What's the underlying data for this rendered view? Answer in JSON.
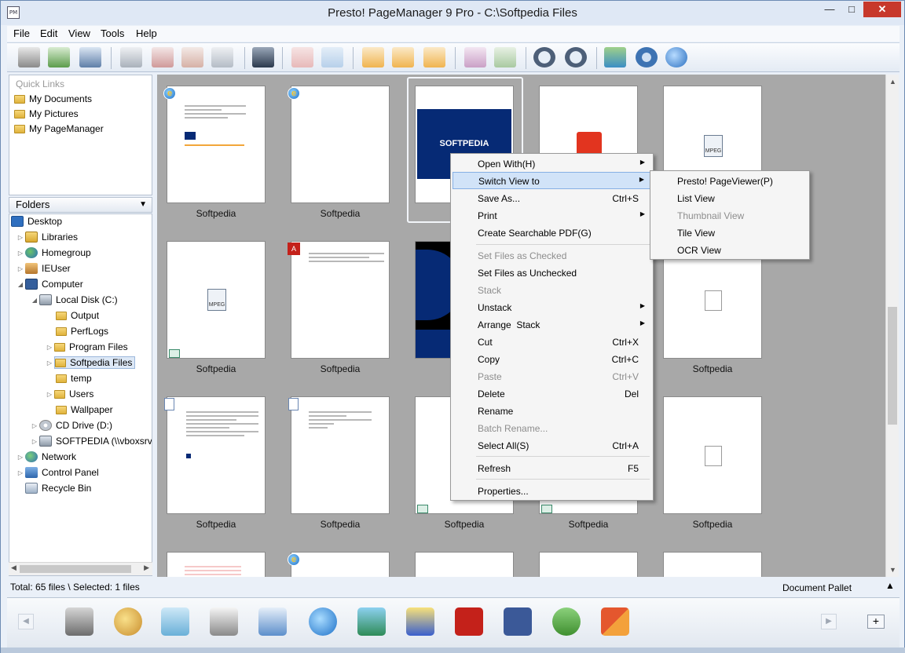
{
  "window": {
    "title": "Presto! PageManager 9 Pro - C:\\Softpedia Files",
    "app_icon_text": "PM",
    "controls": {
      "minimize": "—",
      "maximize": "□",
      "close": "✕"
    }
  },
  "menubar": [
    "File",
    "Edit",
    "View",
    "Tools",
    "Help"
  ],
  "toolbar": {
    "icons": [
      "scanner-icon",
      "acquire-icon",
      "scan-settings-icon",
      "edit-icon",
      "pdf-icon",
      "xps-icon",
      "export-icon",
      "find-icon",
      "stack-icon",
      "unstack-icon",
      "thumbnail-view-icon",
      "list-view-icon",
      "tile-view-icon",
      "page-viewer-icon",
      "ocr-icon",
      "zoom-out-icon",
      "zoom-in-icon",
      "share-icon",
      "settings-icon",
      "update-icon"
    ]
  },
  "quick_links": {
    "title": "Quick Links",
    "items": [
      "My Documents",
      "My Pictures",
      "My PageManager"
    ]
  },
  "folders": {
    "title": "Folders",
    "tree": [
      {
        "label": "Desktop",
        "icon": "desktop-icon"
      },
      {
        "label": "Libraries",
        "icon": "libraries-icon"
      },
      {
        "label": "Homegroup",
        "icon": "homegroup-icon"
      },
      {
        "label": "IEUser",
        "icon": "user-icon"
      },
      {
        "label": "Computer",
        "icon": "computer-icon"
      },
      {
        "label": "Local Disk (C:)",
        "icon": "disk-icon"
      },
      {
        "label": "Output",
        "icon": "folder-icon"
      },
      {
        "label": "PerfLogs",
        "icon": "folder-icon"
      },
      {
        "label": "Program Files",
        "icon": "folder-icon"
      },
      {
        "label": "Softpedia Files",
        "icon": "folder-icon"
      },
      {
        "label": "temp",
        "icon": "folder-icon"
      },
      {
        "label": "Users",
        "icon": "folder-icon"
      },
      {
        "label": "Wallpaper",
        "icon": "folder-icon"
      },
      {
        "label": "CD Drive (D:)",
        "icon": "cd-icon"
      },
      {
        "label": "SOFTPEDIA (\\\\vboxsrv",
        "icon": "network-drive-icon"
      },
      {
        "label": "Network",
        "icon": "network-icon"
      },
      {
        "label": "Control Panel",
        "icon": "control-panel-icon"
      },
      {
        "label": "Recycle Bin",
        "icon": "recycle-bin-icon"
      }
    ]
  },
  "thumbnails": {
    "label": "Softpedia",
    "softpedia_logo_text": "SOFTPEDIA",
    "mpeg_text": "MPEG"
  },
  "status": {
    "left": "Total: 65 files \\ Selected: 1 files",
    "right": "Document Pallet"
  },
  "context_menu": {
    "items": [
      {
        "label": "Open With(H)",
        "shortcut": "",
        "submenu": true,
        "disabled": false
      },
      {
        "label": "Switch View to",
        "shortcut": "",
        "submenu": true,
        "disabled": false
      },
      {
        "label": "Save As...",
        "shortcut": "Ctrl+S",
        "submenu": false,
        "disabled": false
      },
      {
        "label": "Print",
        "shortcut": "",
        "submenu": true,
        "disabled": false
      },
      {
        "label": "Create Searchable PDF(G)",
        "shortcut": "",
        "submenu": false,
        "disabled": false
      },
      {
        "label": "Set Files as Checked",
        "shortcut": "",
        "submenu": false,
        "disabled": true
      },
      {
        "label": "Set Files as Unchecked",
        "shortcut": "",
        "submenu": false,
        "disabled": false
      },
      {
        "label": "Stack",
        "shortcut": "",
        "submenu": false,
        "disabled": true
      },
      {
        "label": "Unstack",
        "shortcut": "",
        "submenu": true,
        "disabled": false
      },
      {
        "label": "Arrange  Stack",
        "shortcut": "",
        "submenu": true,
        "disabled": false
      },
      {
        "label": "Cut",
        "shortcut": "Ctrl+X",
        "submenu": false,
        "disabled": false
      },
      {
        "label": "Copy",
        "shortcut": "Ctrl+C",
        "submenu": false,
        "disabled": false
      },
      {
        "label": "Paste",
        "shortcut": "Ctrl+V",
        "submenu": false,
        "disabled": true
      },
      {
        "label": "Delete",
        "shortcut": "Del",
        "submenu": false,
        "disabled": false
      },
      {
        "label": "Rename",
        "shortcut": "",
        "submenu": false,
        "disabled": false
      },
      {
        "label": "Batch Rename...",
        "shortcut": "",
        "submenu": false,
        "disabled": true
      },
      {
        "label": "Select All(S)",
        "shortcut": "Ctrl+A",
        "submenu": false,
        "disabled": false
      },
      {
        "label": "Refresh",
        "shortcut": "F5",
        "submenu": false,
        "disabled": false
      },
      {
        "label": "Properties...",
        "shortcut": "",
        "submenu": false,
        "disabled": false
      }
    ]
  },
  "submenu": {
    "items": [
      {
        "label": "Presto! PageViewer(P)",
        "disabled": false
      },
      {
        "label": "List View",
        "disabled": false
      },
      {
        "label": "Thumbnail View",
        "disabled": true
      },
      {
        "label": "Tile View",
        "disabled": false
      },
      {
        "label": "OCR View",
        "disabled": false
      }
    ]
  },
  "pallet": {
    "icons": [
      "fax-icon",
      "paint-icon",
      "notepad-icon",
      "printer-icon",
      "wordpad-icon",
      "internet-explorer-icon",
      "screen-capture-icon",
      "paint-brush-icon",
      "acrobat-icon",
      "facebook-icon",
      "evernote-icon",
      "office-icon"
    ],
    "add_label": "+"
  },
  "colors": {
    "title_bar": "#dfe8f5",
    "close_button": "#c7382b",
    "grid_background": "#a8a8a8",
    "highlight": "#d1e3f8",
    "softpedia_blue": "#062a75"
  }
}
